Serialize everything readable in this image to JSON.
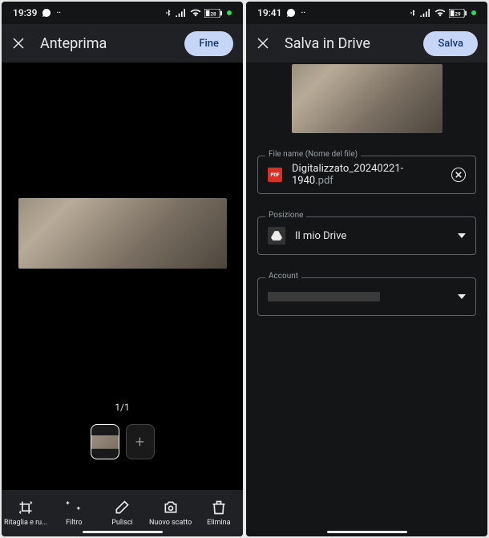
{
  "left": {
    "status": {
      "time": "19:39"
    },
    "header": {
      "title": "Anteprima",
      "action": "Fine"
    },
    "page_counter": "1/1",
    "add_thumb": "+",
    "toolbar": {
      "crop": "Ritaglia e ru...",
      "filter": "Filtro",
      "clean": "Pulisci",
      "retake": "Nuovo scatto",
      "delete": "Elimina"
    }
  },
  "right": {
    "status": {
      "time": "19:41"
    },
    "header": {
      "title": "Salva in Drive",
      "action": "Salva"
    },
    "fields": {
      "filename": {
        "legend": "File name (Nome del file)",
        "value": "Digitalizzato_20240221-1940",
        "ext": ".pdf",
        "badge": "PDF"
      },
      "location": {
        "legend": "Posizione",
        "value": "Il mio Drive"
      },
      "account": {
        "legend": "Account"
      }
    }
  }
}
